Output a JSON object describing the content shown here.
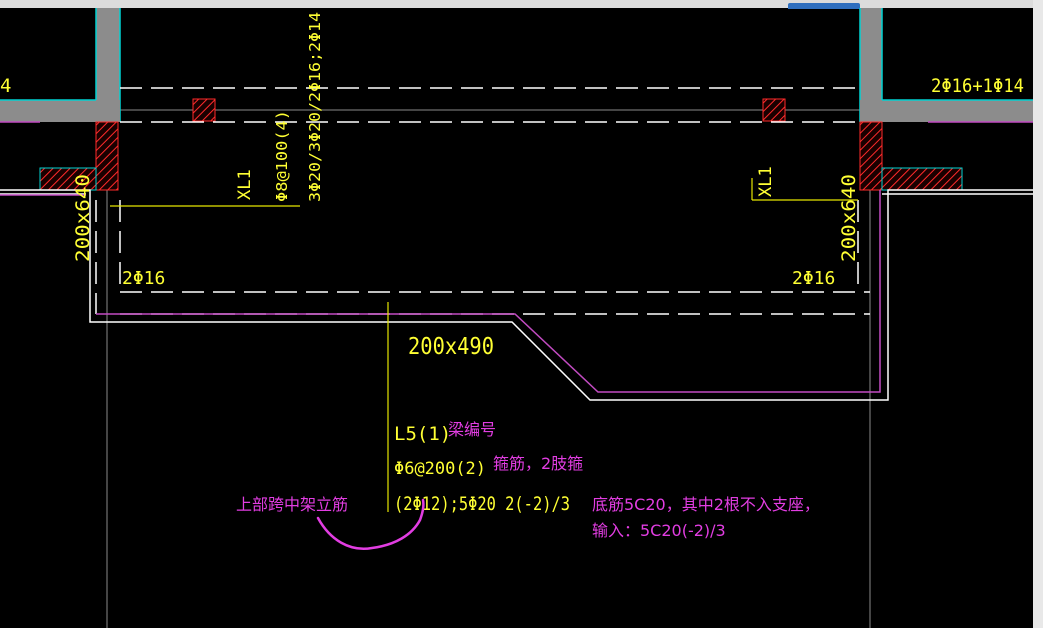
{
  "window": {
    "top_bar_partial_text": "",
    "accent_tab_color": "#2f6fbf"
  },
  "colors": {
    "background": "#000000",
    "beam_text": "#ffff33",
    "annotation": "#e23de2",
    "wall_cyan": "#00d2d2",
    "hatch_red": "#ff2a2a",
    "line_white": "#ffffff",
    "line_magenta": "#c24bc2",
    "guide_gray": "#9a9a9a"
  },
  "drawing": {
    "top_left_rebar": "4",
    "top_right_rebar": "2Φ16+1Φ14",
    "left_column_size": "200x640",
    "right_column_size": "200x640",
    "beam_name_left": "XL1",
    "beam_name_right": "XL1",
    "stirrup_vertical": "Φ8@100(4)",
    "top_bars_vertical": "3Φ20/3Φ20/2Φ16;2Φ14",
    "bottom_left_rebar": "2Φ16",
    "bottom_right_rebar": "2Φ16",
    "beam_section": "200x490",
    "leader": {
      "beam_id": "L5(1)",
      "stirrup": "Φ6@200(2)",
      "reinforcement": "(2Φ12);5Φ20 2(-2)/3"
    }
  },
  "annotations": {
    "beam_id_note": "梁编号",
    "stirrup_note": "箍筋，2肢箍",
    "erection_bar_note": "上部跨中架立筋",
    "bottom_bar_note_line1": "底筋5C20，其中2根不入支座，",
    "bottom_bar_note_line2": "输入：5C20(-2)/3"
  }
}
